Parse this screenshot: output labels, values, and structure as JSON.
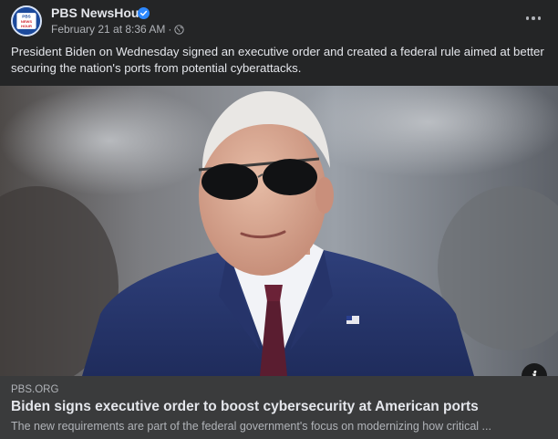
{
  "post": {
    "page_name": "PBS NewsHour",
    "avatar_logo_text": "PBS NEWS HOUR",
    "timestamp": "February 21 at 8:36 AM",
    "separator": "·",
    "privacy_icon": "globe-icon",
    "verified_icon": "verified-badge-icon",
    "more_icon": "more-options-icon",
    "caption": "President Biden on Wednesday signed an executive order and created a federal rule aimed at better securing the nation's ports from potential cyberattacks."
  },
  "link_preview": {
    "domain": "PBS.ORG",
    "title": "Biden signs executive order to boost cybersecurity at American ports",
    "description": "The new requirements are part of the federal government's focus on modernizing how critical ...",
    "info_icon": "info-icon",
    "info_label": "i"
  },
  "colors": {
    "background": "#242526",
    "link_background": "#3a3b3c",
    "primary_text": "#e4e6eb",
    "secondary_text": "#b0b3b8",
    "verified_blue": "#2d88ff"
  }
}
